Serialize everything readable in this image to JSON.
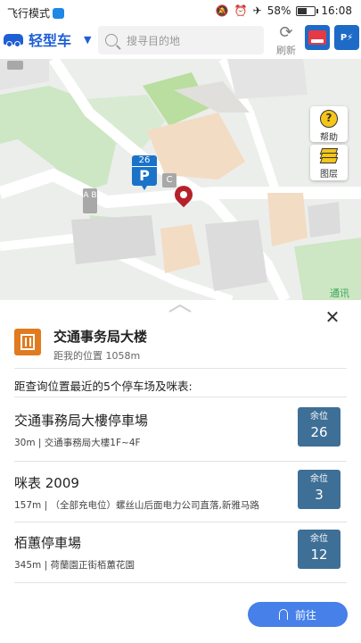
{
  "status_bar": {
    "airplane_mode_label": "飞行模式",
    "battery_percent": "58%",
    "battery_level": 0.58,
    "time": "16:08"
  },
  "toolbar": {
    "vehicle_type": "轻型车",
    "search_placeholder": "搜寻目的地",
    "refresh_label": "刷新"
  },
  "map": {
    "help_label": "帮助",
    "layers_label": "图层",
    "parking_marker_count": "26",
    "parking_marker_letter": "P",
    "label_c": "C",
    "label_ab": "A B",
    "green_label": "通讯"
  },
  "sheet": {
    "poi_title": "交通事务局大楼",
    "poi_distance": "距我的位置 1058m",
    "nearest_header": "距查询位置最近的5个停车场及咪表:",
    "badge_label": "余位",
    "lots": [
      {
        "name": "交通事務局大樓停車場",
        "detail": "30m | 交通事務局大樓1F~4F",
        "spaces": "26"
      },
      {
        "name": "咪表 2009",
        "detail": "157m | （全部充电位）螺丝山后面电力公司直落,新雅马路",
        "spaces": "3"
      },
      {
        "name": "栢蕙停車場",
        "detail": "345m | 荷蘭園正街栢蕙花園",
        "spaces": "12"
      }
    ],
    "go_label": "前往"
  },
  "colors": {
    "accent_blue": "#1e5fd6",
    "badge_blue": "#3e6f96",
    "go_button": "#4680e8",
    "pin_red": "#b5212b",
    "poi_orange": "#e07b1f"
  }
}
